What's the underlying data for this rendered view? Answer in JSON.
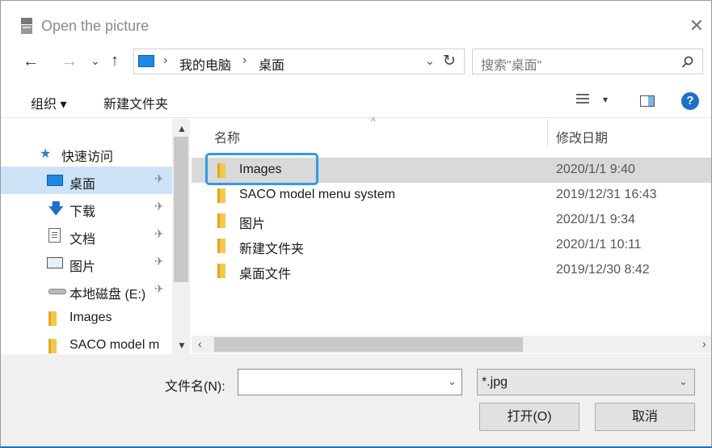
{
  "window": {
    "title": "Open the picture",
    "close_icon": "close-icon"
  },
  "navigation": {
    "back": "←",
    "forward": "→",
    "recent": "⌄",
    "up": "↑",
    "breadcrumb": [
      "我的电脑",
      "桌面"
    ],
    "separator": "›",
    "refresh": "↻",
    "dropdown": "⌄"
  },
  "search": {
    "placeholder": "搜索\"桌面\"",
    "icon": "search-icon"
  },
  "toolbar": {
    "organize": "组织 ▾",
    "new_folder": "新建文件夹",
    "view_dropdown": "▾",
    "help": "?"
  },
  "nav_pane": {
    "items": [
      {
        "label": "快速访问",
        "icon": "star-icon"
      },
      {
        "label": "桌面",
        "icon": "desktop-icon",
        "pinned": true
      },
      {
        "label": "下载",
        "icon": "download-icon",
        "pinned": true
      },
      {
        "label": "文档",
        "icon": "document-icon",
        "pinned": true
      },
      {
        "label": "图片",
        "icon": "picture-icon",
        "pinned": true
      },
      {
        "label": "本地磁盘 (E:)",
        "icon": "drive-icon",
        "pinned": true
      },
      {
        "label": "Images",
        "icon": "folder-icon"
      },
      {
        "label": "SACO model m",
        "icon": "folder-icon"
      }
    ],
    "pin": "✈"
  },
  "file_list": {
    "columns": {
      "name": "名称",
      "date": "修改日期"
    },
    "sort_indicator": "^",
    "rows": [
      {
        "name": "Images",
        "date": "2020/1/1 9:40"
      },
      {
        "name": "SACO model menu system",
        "date": "2019/12/31 16:43"
      },
      {
        "name": "图片",
        "date": "2020/1/1 9:34"
      },
      {
        "name": "新建文件夹",
        "date": "2020/1/1 10:11"
      },
      {
        "name": "桌面文件",
        "date": "2019/12/30 8:42"
      }
    ]
  },
  "bottom": {
    "filename_label": "文件名(N):",
    "filename_value": "",
    "filter": "*.jpg",
    "open_button": "打开(O)",
    "cancel_button": "取消"
  },
  "colors": {
    "accent": "#1e6fc8",
    "selection": "#cde3f7",
    "highlight_box": "#2e9be8"
  }
}
